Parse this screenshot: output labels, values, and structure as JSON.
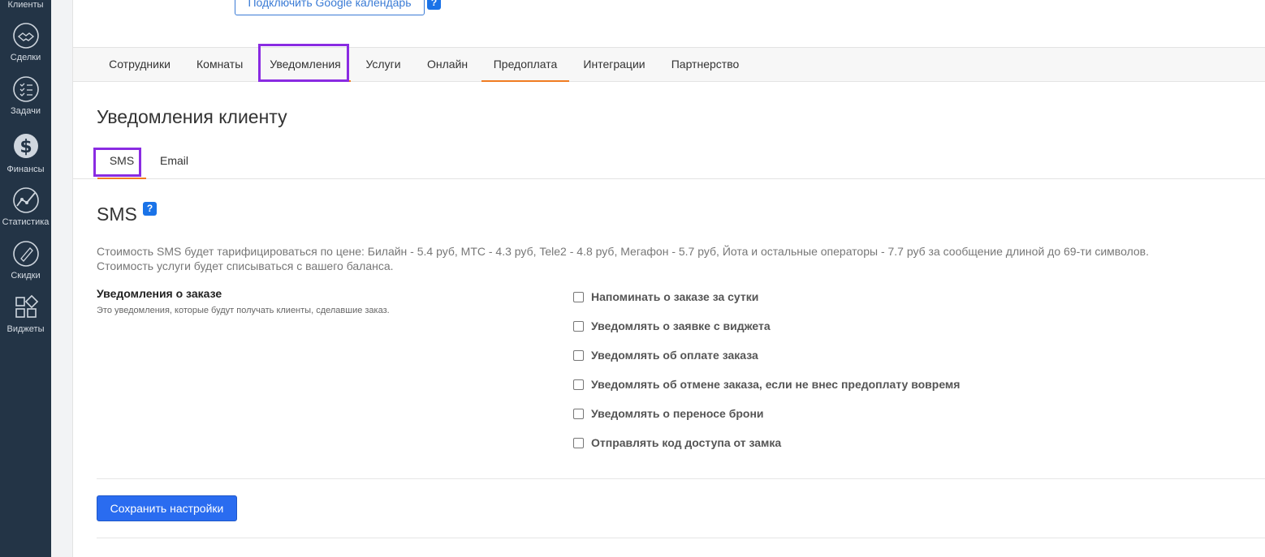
{
  "sidebar": {
    "items": [
      {
        "label": "Клиенты",
        "icon": "clients-icon"
      },
      {
        "label": "Сделки",
        "icon": "handshake-icon"
      },
      {
        "label": "Задачи",
        "icon": "tasks-list-icon"
      },
      {
        "label": "Финансы",
        "icon": "dollar-icon"
      },
      {
        "label": "Статистика",
        "icon": "chart-line-icon"
      },
      {
        "label": "Скидки",
        "icon": "sale-tag-icon"
      },
      {
        "label": "Виджеты",
        "icon": "widgets-icon"
      }
    ]
  },
  "top": {
    "google_calendar_button": "Подключить Google календарь",
    "help": "?"
  },
  "main_tabs": [
    {
      "label": "Сотрудники"
    },
    {
      "label": "Комнаты"
    },
    {
      "label": "Уведомления"
    },
    {
      "label": "Услуги"
    },
    {
      "label": "Онлайн"
    },
    {
      "label": "Предоплата"
    },
    {
      "label": "Интеграции"
    },
    {
      "label": "Партнерство"
    }
  ],
  "page": {
    "title": "Уведомления клиенту",
    "sub_tabs": [
      {
        "label": "SMS"
      },
      {
        "label": "Email"
      }
    ],
    "section_title": "SMS",
    "section_help": "?",
    "description_line1": "Стоимость SMS будет тарифицироваться по цене: Билайн - 5.4 руб, МТС - 4.3 руб, Tele2 - 4.8 руб, Мегафон - 5.7 руб, Йота и остальные операторы - 7.7 руб за сообщение длиной до 69-ти символов.",
    "description_line2": "Стоимость услуги будет списываться с вашего баланса.",
    "group_title": "Уведомления о заказе",
    "group_desc": "Это уведомления, которые будут получать клиенты, сделавшие заказ.",
    "options": [
      {
        "label": "Напоминать о заказе за сутки",
        "checked": false
      },
      {
        "label": "Уведомлять о заявке с виджета",
        "checked": false
      },
      {
        "label": "Уведомлять об оплате заказа",
        "checked": false
      },
      {
        "label": "Уведомлять об отмене заказа, если не внес предоплату вовремя",
        "checked": false
      },
      {
        "label": "Уведомлять о переносе брони",
        "checked": false
      },
      {
        "label": "Отправлять код доступа от замка",
        "checked": false
      }
    ],
    "save_button": "Сохранить настройки"
  },
  "colors": {
    "sidebar_bg": "#233446",
    "accent_orange": "#f07c22",
    "primary_blue": "#2a6cf0",
    "highlight_purple": "#8a2be2"
  }
}
